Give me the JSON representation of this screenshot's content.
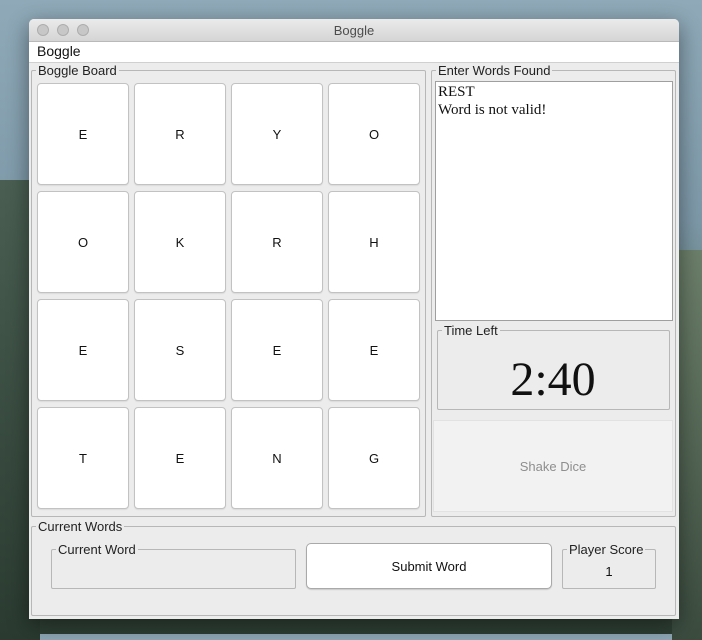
{
  "window": {
    "title": "Boggle"
  },
  "menu": {
    "items": [
      "Boggle"
    ]
  },
  "board": {
    "label": "Boggle Board",
    "rows": [
      [
        "E",
        "R",
        "Y",
        "O"
      ],
      [
        "O",
        "K",
        "R",
        "H"
      ],
      [
        "E",
        "S",
        "E",
        "E"
      ],
      [
        "T",
        "E",
        "N",
        "G"
      ]
    ]
  },
  "words_panel": {
    "label": "Enter Words Found",
    "lines": [
      "REST",
      "Word is not valid!"
    ]
  },
  "timer": {
    "label": "Time Left",
    "value": "2:40"
  },
  "shake_button": {
    "label": "Shake Dice"
  },
  "current_words": {
    "label": "Current Words",
    "current_word_label": "Current Word",
    "current_word_value": "",
    "submit_label": "Submit Word",
    "score_label": "Player Score",
    "score_value": "1"
  }
}
